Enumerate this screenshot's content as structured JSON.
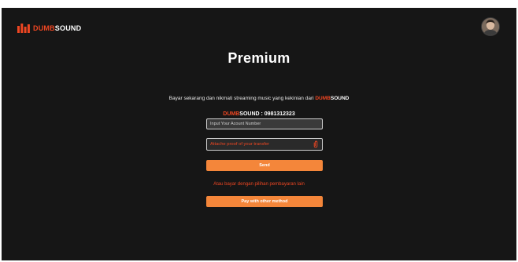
{
  "brand": {
    "accent": "DUMB",
    "rest": "SOUND"
  },
  "page": {
    "title": "Premium"
  },
  "info": {
    "text": "Bayar sekarang dan nikmati streaming music yang kekinian dari "
  },
  "account": {
    "number_text": " : 0981312323"
  },
  "form": {
    "account_placeholder": "Input Your Acount Number",
    "proof_label": "Attache proof of your transfer",
    "send_label": "Send"
  },
  "alternative": {
    "text": "Atau bayar dengan pilihan pembayaran lain",
    "button_label": "Pay with other method"
  },
  "colors": {
    "background": "#161616",
    "brand_accent": "#ee4622",
    "button": "#f4863a"
  },
  "icons": {
    "logo": "dumbsound-logo-icon",
    "attachment": "attachment-icon",
    "avatar": "user-avatar"
  }
}
